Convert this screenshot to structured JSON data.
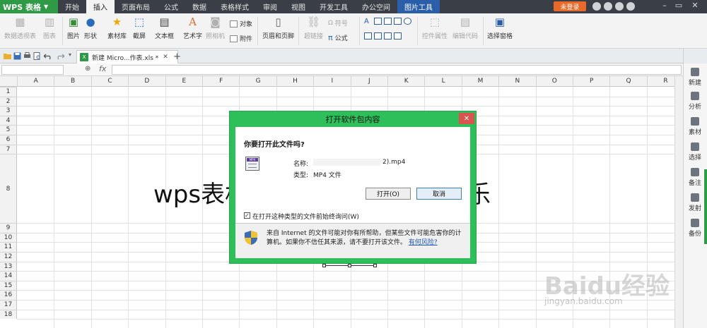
{
  "app": {
    "brand": "WPS 表格",
    "login": "未登录"
  },
  "menu": {
    "tabs": [
      "开始",
      "插入",
      "页面布局",
      "公式",
      "数据",
      "表格样式",
      "审阅",
      "视图",
      "开发工具",
      "办公空间",
      "图片工具"
    ],
    "active": "插入",
    "tool_tab": "图片工具"
  },
  "ribbon": {
    "pivot": "数据透视表",
    "chart": "图表",
    "picture": "图片",
    "shapes": "形状",
    "material": "素材库",
    "screenshot": "截屏",
    "textbox": "文本框",
    "wordart": "艺术字",
    "camera": "照相机",
    "object": "对象",
    "attachment": "附件",
    "header_footer": "页眉和页脚",
    "hyperlink": "超链接",
    "symbol": "符号",
    "formula": "公式",
    "control_props": "控件属性",
    "edit_code": "编辑代码",
    "select_pane": "选择窗格"
  },
  "document": {
    "tab_title": "新建 Micro...作表.xls *"
  },
  "formula_bar": {
    "fx": "fx"
  },
  "grid": {
    "columns": [
      "A",
      "B",
      "C",
      "D",
      "E",
      "F",
      "G",
      "H",
      "I",
      "J",
      "K",
      "L",
      "M",
      "N",
      "O",
      "P",
      "Q",
      "R"
    ],
    "rows": [
      "1",
      "2",
      "3",
      "4",
      "5",
      "6",
      "7",
      "8",
      "9",
      "10",
      "11",
      "12",
      "13",
      "14",
      "15",
      "16",
      "17",
      "18"
    ],
    "cell_text_left": "wps表格",
    "cell_text_right": "乐"
  },
  "task_pane": {
    "items": [
      "新建",
      "分析",
      "素材",
      "选择",
      "备注",
      "发射",
      "备份"
    ]
  },
  "dialog": {
    "title": "打开软件包内容",
    "question": "你要打开此文件吗?",
    "name_label": "名称:",
    "name_value": "2).mp4",
    "type_label": "类型:",
    "type_value": "MP4 文件",
    "open_button": "打开(O)",
    "cancel_button": "取消",
    "checkbox_label": "在打开这种类型的文件前始终询问(W)",
    "checkbox_checked": true,
    "warning_text": "来自 Internet 的文件可能对你有所帮助，但某些文件可能危害你的计算机。如果你不信任其来源，请不要打开该文件。",
    "warning_link": "有何风险?"
  },
  "watermark": {
    "main": "Baidu经验",
    "sub": "jingyan.baidu.com"
  }
}
